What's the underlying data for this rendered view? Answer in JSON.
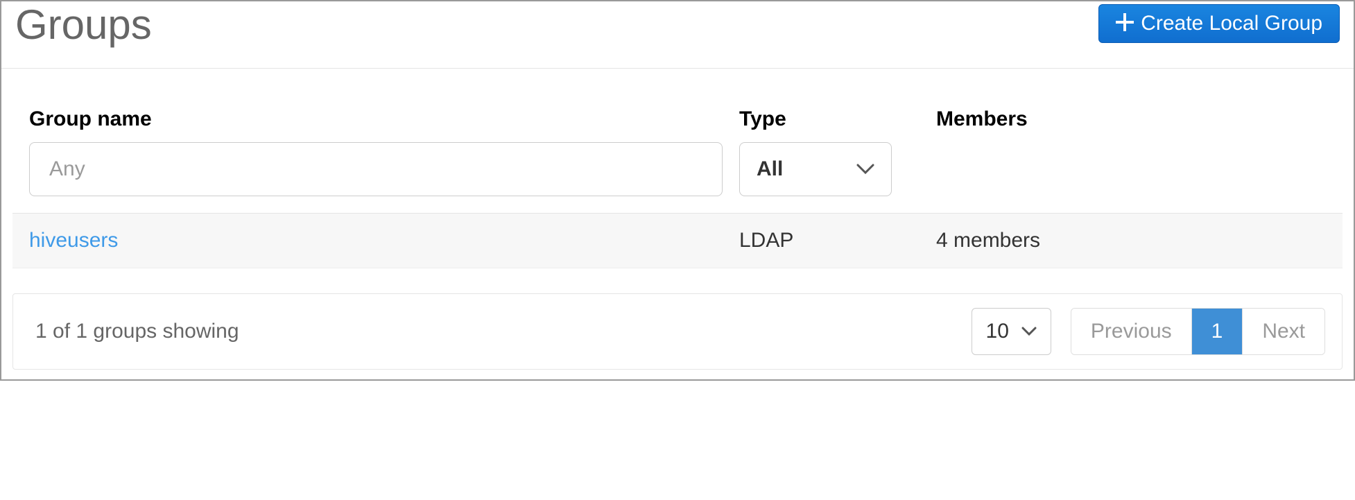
{
  "header": {
    "title": "Groups",
    "create_button": "Create Local Group"
  },
  "filters": {
    "group_name": {
      "label": "Group name",
      "placeholder": "Any",
      "value": ""
    },
    "type": {
      "label": "Type",
      "selected": "All"
    },
    "members": {
      "label": "Members"
    }
  },
  "rows": [
    {
      "name": "hiveusers",
      "type": "LDAP",
      "members": "4 members"
    }
  ],
  "footer": {
    "status": "1 of 1 groups showing",
    "page_size": "10",
    "previous": "Previous",
    "current_page": "1",
    "next": "Next"
  }
}
